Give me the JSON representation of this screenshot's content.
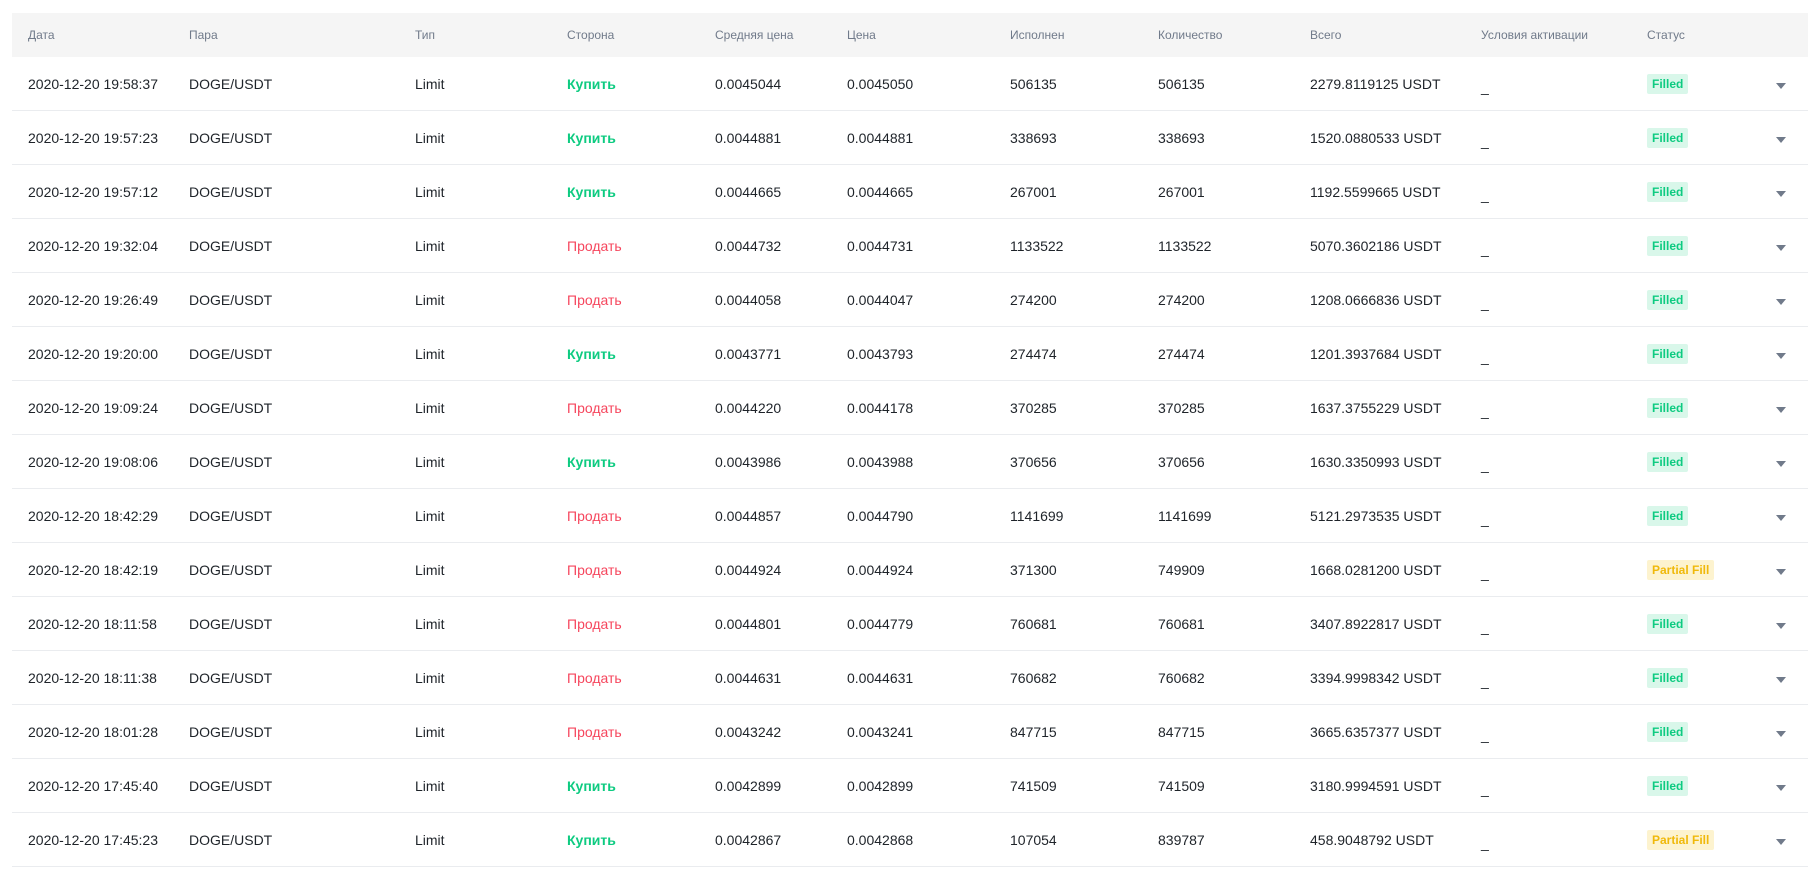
{
  "table": {
    "columns": {
      "date": "Дата",
      "pair": "Пара",
      "type": "Тип",
      "side": "Сторона",
      "avg_price": "Средняя цена",
      "price": "Цена",
      "filled": "Исполнен",
      "amount": "Количество",
      "total": "Всего",
      "trigger": "Условия активации",
      "status": "Статус"
    },
    "rows": [
      {
        "date": "2020-12-20 19:58:37",
        "pair": "DOGE/USDT",
        "type": "Limit",
        "side": "Купить",
        "side_kind": "buy",
        "avg_price": "0.0045044",
        "price": "0.0045050",
        "filled": "506135",
        "amount": "506135",
        "total": "2279.8119125 USDT",
        "trigger": "_",
        "status": "Filled",
        "status_kind": "filled"
      },
      {
        "date": "2020-12-20 19:57:23",
        "pair": "DOGE/USDT",
        "type": "Limit",
        "side": "Купить",
        "side_kind": "buy",
        "avg_price": "0.0044881",
        "price": "0.0044881",
        "filled": "338693",
        "amount": "338693",
        "total": "1520.0880533 USDT",
        "trigger": "_",
        "status": "Filled",
        "status_kind": "filled"
      },
      {
        "date": "2020-12-20 19:57:12",
        "pair": "DOGE/USDT",
        "type": "Limit",
        "side": "Купить",
        "side_kind": "buy",
        "avg_price": "0.0044665",
        "price": "0.0044665",
        "filled": "267001",
        "amount": "267001",
        "total": "1192.5599665 USDT",
        "trigger": "_",
        "status": "Filled",
        "status_kind": "filled"
      },
      {
        "date": "2020-12-20 19:32:04",
        "pair": "DOGE/USDT",
        "type": "Limit",
        "side": "Продать",
        "side_kind": "sell",
        "avg_price": "0.0044732",
        "price": "0.0044731",
        "filled": "1133522",
        "amount": "1133522",
        "total": "5070.3602186 USDT",
        "trigger": "_",
        "status": "Filled",
        "status_kind": "filled"
      },
      {
        "date": "2020-12-20 19:26:49",
        "pair": "DOGE/USDT",
        "type": "Limit",
        "side": "Продать",
        "side_kind": "sell",
        "avg_price": "0.0044058",
        "price": "0.0044047",
        "filled": "274200",
        "amount": "274200",
        "total": "1208.0666836 USDT",
        "trigger": "_",
        "status": "Filled",
        "status_kind": "filled"
      },
      {
        "date": "2020-12-20 19:20:00",
        "pair": "DOGE/USDT",
        "type": "Limit",
        "side": "Купить",
        "side_kind": "buy",
        "avg_price": "0.0043771",
        "price": "0.0043793",
        "filled": "274474",
        "amount": "274474",
        "total": "1201.3937684 USDT",
        "trigger": "_",
        "status": "Filled",
        "status_kind": "filled"
      },
      {
        "date": "2020-12-20 19:09:24",
        "pair": "DOGE/USDT",
        "type": "Limit",
        "side": "Продать",
        "side_kind": "sell",
        "avg_price": "0.0044220",
        "price": "0.0044178",
        "filled": "370285",
        "amount": "370285",
        "total": "1637.3755229 USDT",
        "trigger": "_",
        "status": "Filled",
        "status_kind": "filled"
      },
      {
        "date": "2020-12-20 19:08:06",
        "pair": "DOGE/USDT",
        "type": "Limit",
        "side": "Купить",
        "side_kind": "buy",
        "avg_price": "0.0043986",
        "price": "0.0043988",
        "filled": "370656",
        "amount": "370656",
        "total": "1630.3350993 USDT",
        "trigger": "_",
        "status": "Filled",
        "status_kind": "filled"
      },
      {
        "date": "2020-12-20 18:42:29",
        "pair": "DOGE/USDT",
        "type": "Limit",
        "side": "Продать",
        "side_kind": "sell",
        "avg_price": "0.0044857",
        "price": "0.0044790",
        "filled": "1141699",
        "amount": "1141699",
        "total": "5121.2973535 USDT",
        "trigger": "_",
        "status": "Filled",
        "status_kind": "filled"
      },
      {
        "date": "2020-12-20 18:42:19",
        "pair": "DOGE/USDT",
        "type": "Limit",
        "side": "Продать",
        "side_kind": "sell",
        "avg_price": "0.0044924",
        "price": "0.0044924",
        "filled": "371300",
        "amount": "749909",
        "total": "1668.0281200 USDT",
        "trigger": "_",
        "status": "Partial Fill",
        "status_kind": "partial"
      },
      {
        "date": "2020-12-20 18:11:58",
        "pair": "DOGE/USDT",
        "type": "Limit",
        "side": "Продать",
        "side_kind": "sell",
        "avg_price": "0.0044801",
        "price": "0.0044779",
        "filled": "760681",
        "amount": "760681",
        "total": "3407.8922817 USDT",
        "trigger": "_",
        "status": "Filled",
        "status_kind": "filled"
      },
      {
        "date": "2020-12-20 18:11:38",
        "pair": "DOGE/USDT",
        "type": "Limit",
        "side": "Продать",
        "side_kind": "sell",
        "avg_price": "0.0044631",
        "price": "0.0044631",
        "filled": "760682",
        "amount": "760682",
        "total": "3394.9998342 USDT",
        "trigger": "_",
        "status": "Filled",
        "status_kind": "filled"
      },
      {
        "date": "2020-12-20 18:01:28",
        "pair": "DOGE/USDT",
        "type": "Limit",
        "side": "Продать",
        "side_kind": "sell",
        "avg_price": "0.0043242",
        "price": "0.0043241",
        "filled": "847715",
        "amount": "847715",
        "total": "3665.6357377 USDT",
        "trigger": "_",
        "status": "Filled",
        "status_kind": "filled"
      },
      {
        "date": "2020-12-20 17:45:40",
        "pair": "DOGE/USDT",
        "type": "Limit",
        "side": "Купить",
        "side_kind": "buy",
        "avg_price": "0.0042899",
        "price": "0.0042899",
        "filled": "741509",
        "amount": "741509",
        "total": "3180.9994591 USDT",
        "trigger": "_",
        "status": "Filled",
        "status_kind": "filled"
      },
      {
        "date": "2020-12-20 17:45:23",
        "pair": "DOGE/USDT",
        "type": "Limit",
        "side": "Купить",
        "side_kind": "buy",
        "avg_price": "0.0042867",
        "price": "0.0042868",
        "filled": "107054",
        "amount": "839787",
        "total": "458.9048792 USDT",
        "trigger": "_",
        "status": "Partial Fill",
        "status_kind": "partial"
      }
    ]
  },
  "colors": {
    "buy": "#0ecb81",
    "sell": "#f6465d",
    "filled_bg": "#d9f7ea",
    "partial_bg": "#fdf3cf",
    "partial_text": "#f0b90b"
  },
  "icons": {
    "row_expand": "chevron-down-icon"
  }
}
